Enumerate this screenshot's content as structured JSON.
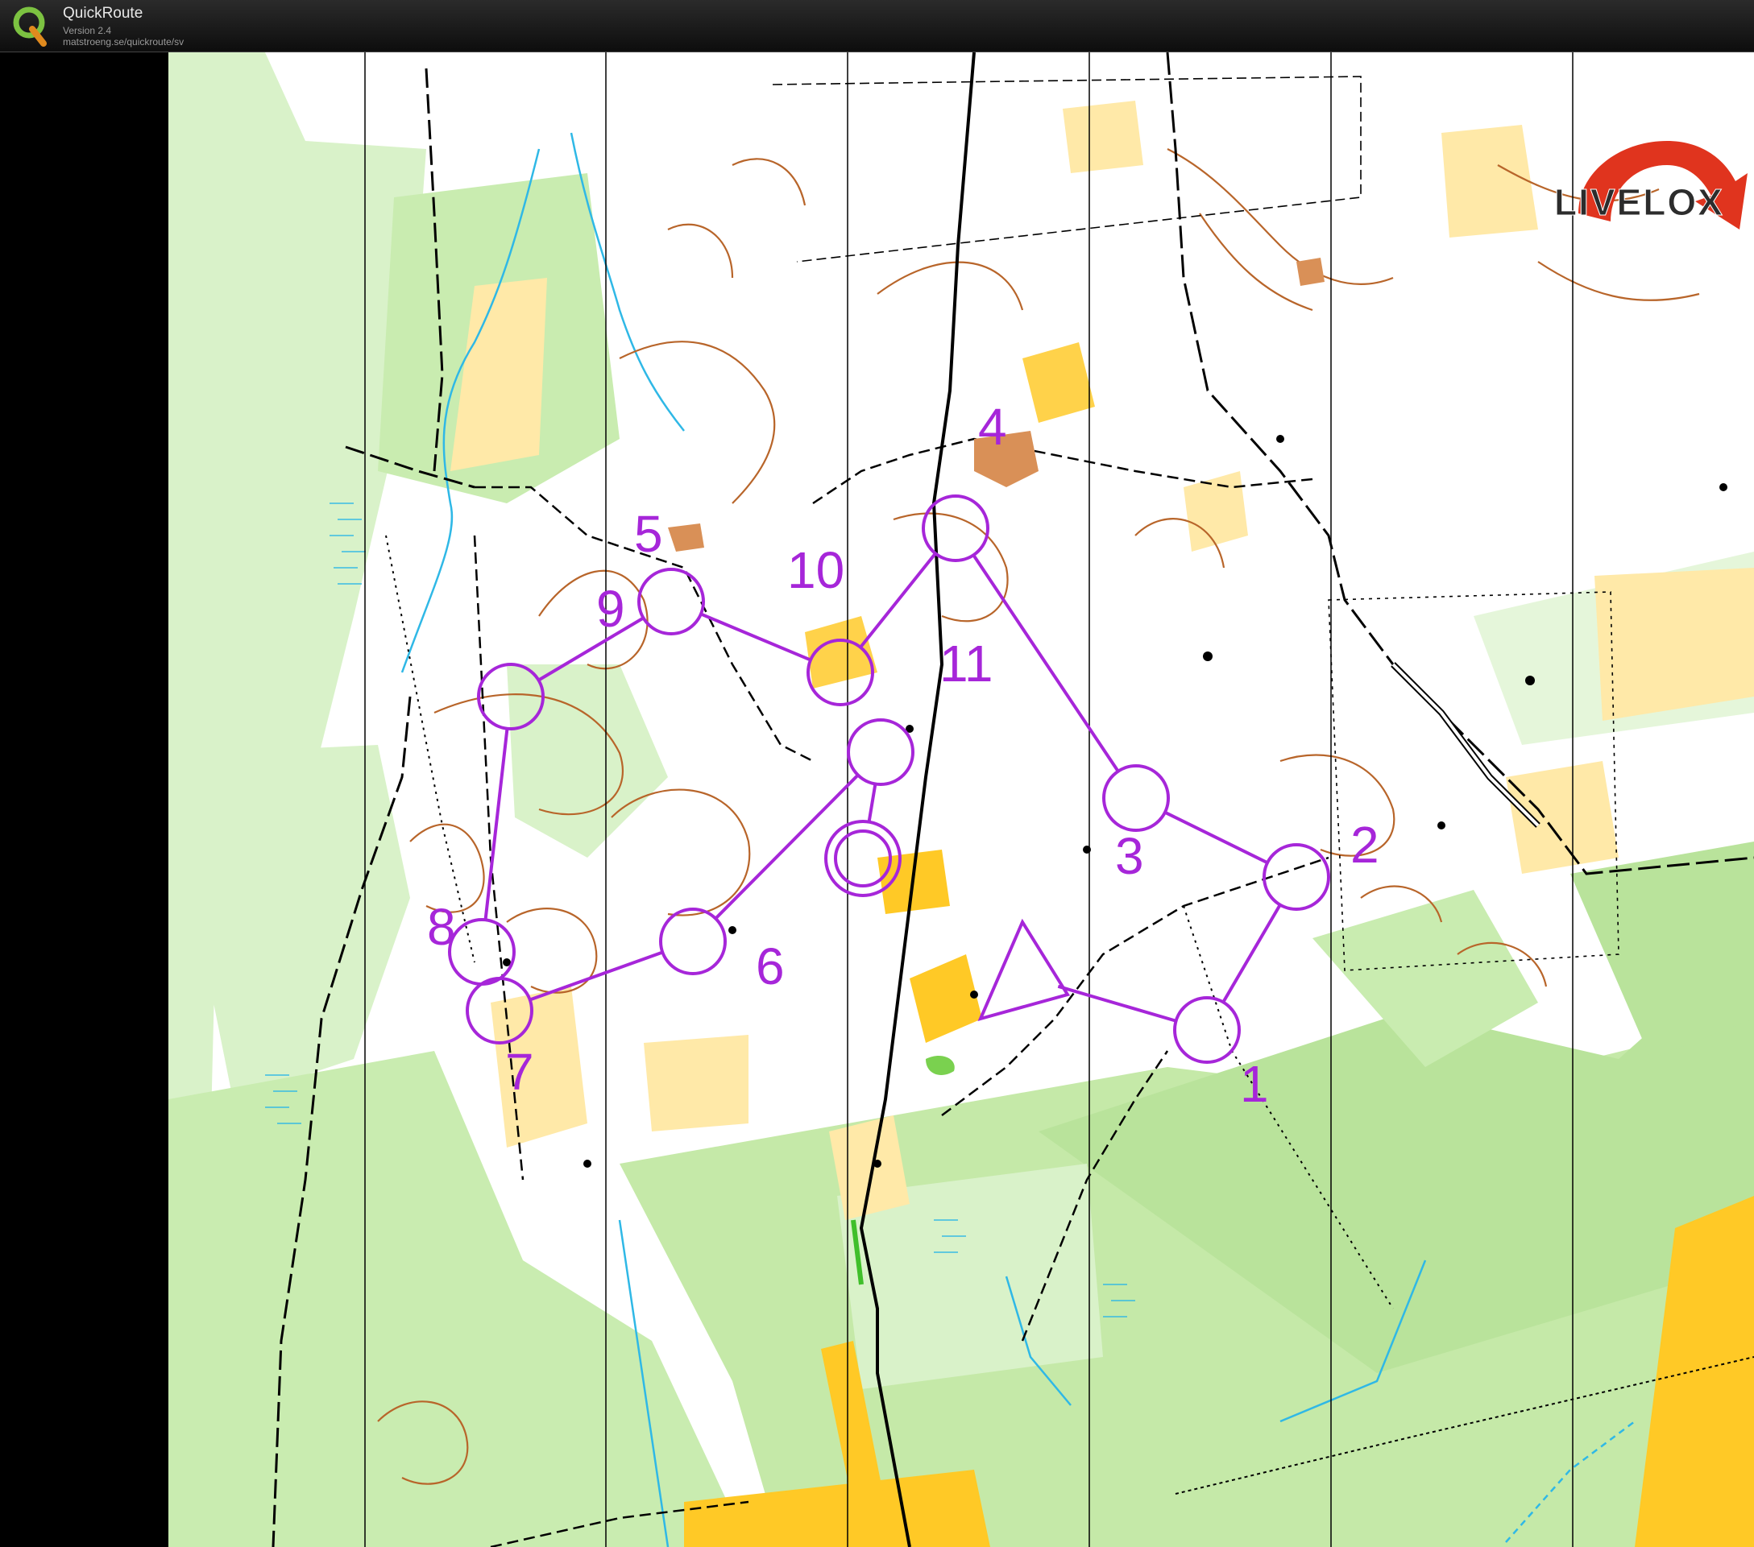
{
  "window": {
    "title": "QuickRoute",
    "version": "Version 2.4",
    "url": "matstroeng.se/quickroute/sv"
  },
  "watermark": {
    "brand": "LIVELOX"
  },
  "course": {
    "color": "#a626d9",
    "start": {
      "label": "start"
    },
    "controls": [
      {
        "number": "1"
      },
      {
        "number": "2"
      },
      {
        "number": "3"
      },
      {
        "number": "4"
      },
      {
        "number": "5"
      },
      {
        "number": "6"
      },
      {
        "number": "7"
      },
      {
        "number": "8"
      },
      {
        "number": "9"
      },
      {
        "number": "10"
      },
      {
        "number": "11"
      }
    ],
    "finish": {
      "label": "finish"
    }
  },
  "map_colors": {
    "open_land": "#ffffff",
    "light_green": "#d9f2c9",
    "medium_green": "#b9e39b",
    "yellow_open": "#ffd24a",
    "rough_open": "#ffe9a8",
    "contour": "#b8652a",
    "water": "#2fb8e6",
    "north_lines": "#000000"
  }
}
